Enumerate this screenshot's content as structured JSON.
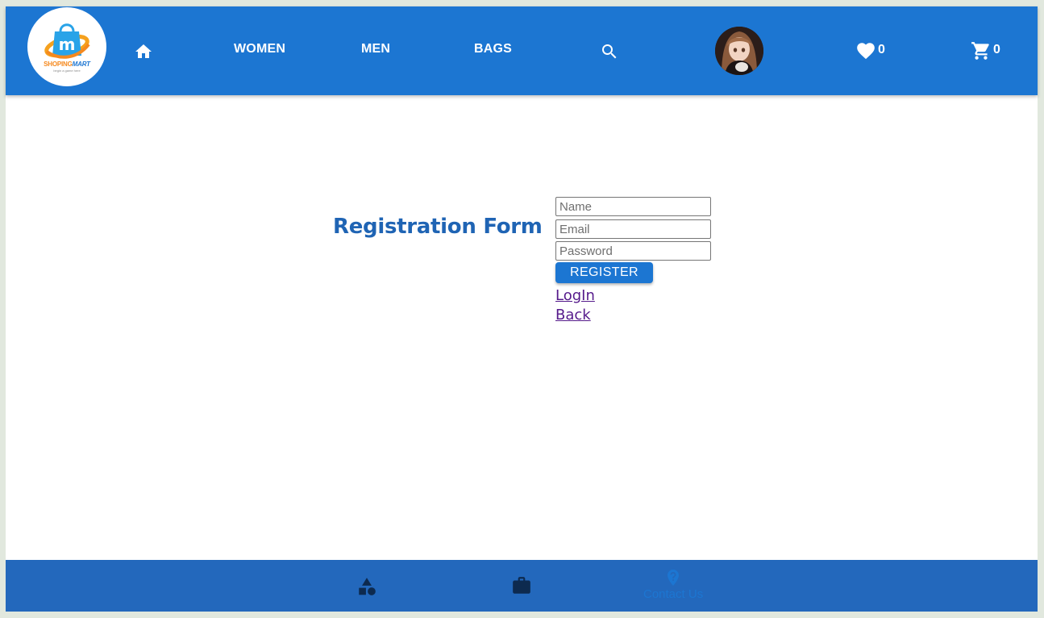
{
  "header": {
    "logo": {
      "brand_part1": "SHOPING",
      "brand_part2": "MART",
      "tagline": "begin a game here"
    },
    "nav": {
      "women": "WOMEN",
      "men": "MEN",
      "bags": "BAGS"
    },
    "wishlist_count": "0",
    "cart_count": "0"
  },
  "form": {
    "title": "Registration Form",
    "name_placeholder": "Name",
    "email_placeholder": "Email",
    "password_placeholder": "Password",
    "register_label": "REGISTER",
    "login_link": "LogIn",
    "back_link": "Back"
  },
  "footer": {
    "contact_label": "Contact Us"
  },
  "colors": {
    "primary": "#1c76d2",
    "footer": "#2368bc",
    "title": "#1f64b4",
    "visited_link": "#551a8b",
    "icon_dark": "#0d2a4f"
  },
  "icons": [
    "home-icon",
    "search-icon",
    "heart-icon",
    "cart-icon",
    "category-icon",
    "briefcase-icon",
    "help-icon"
  ]
}
